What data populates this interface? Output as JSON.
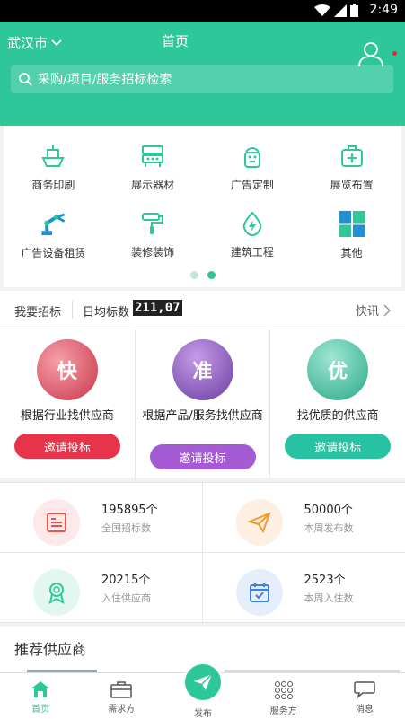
{
  "status_bar": {
    "time": "2:49"
  },
  "header": {
    "city": "武汉市",
    "title": "首页"
  },
  "search": {
    "placeholder": "采购/项目/服务招标检索"
  },
  "categories": [
    {
      "label": "商务印刷",
      "icon": "ship-icon"
    },
    {
      "label": "展示器材",
      "icon": "display-rack-icon"
    },
    {
      "label": "广告定制",
      "icon": "android-icon"
    },
    {
      "label": "展览布置",
      "icon": "medical-kit-icon"
    },
    {
      "label": "广告设备租赁",
      "icon": "robot-arm-icon"
    },
    {
      "label": "装修装饰",
      "icon": "paint-roller-icon"
    },
    {
      "label": "建筑工程",
      "icon": "energy-drop-icon"
    },
    {
      "label": "其他",
      "icon": "grid-icon"
    }
  ],
  "bid_bar": {
    "label": "我要招标",
    "daily_label": "日均标数",
    "daily_count": "211,07",
    "flash": "快讯"
  },
  "cards": [
    {
      "badge": "快",
      "title": "根据行业找供应商",
      "button": "邀请投标",
      "color": "#e7344a"
    },
    {
      "badge": "准",
      "title": "根据产品/服务找供应商",
      "button": "邀请投标",
      "color": "#a45bd3"
    },
    {
      "badge": "优",
      "title": "找优质的供应商",
      "button": "邀请投标",
      "color": "#26c2a2"
    }
  ],
  "stats": [
    {
      "value": "195895个",
      "label": "全国招标数",
      "icon": "document-icon"
    },
    {
      "value": "50000个",
      "label": "本周发布数",
      "icon": "paper-plane-icon"
    },
    {
      "value": "20215个",
      "label": "入住供应商",
      "icon": "award-icon"
    },
    {
      "value": "2523个",
      "label": "本周入住数",
      "icon": "calendar-icon"
    }
  ],
  "recommend": {
    "title": "推荐供应商"
  },
  "tabs": [
    {
      "label": "首页",
      "icon": "home-icon"
    },
    {
      "label": "需求方",
      "icon": "briefcase-icon"
    },
    {
      "label": "发布",
      "icon": "send-icon"
    },
    {
      "label": "服务方",
      "icon": "dots-grid-icon"
    },
    {
      "label": "消息",
      "icon": "chat-icon"
    }
  ],
  "colors": {
    "brand": "#2dc79a",
    "alert": "#e8253b"
  }
}
